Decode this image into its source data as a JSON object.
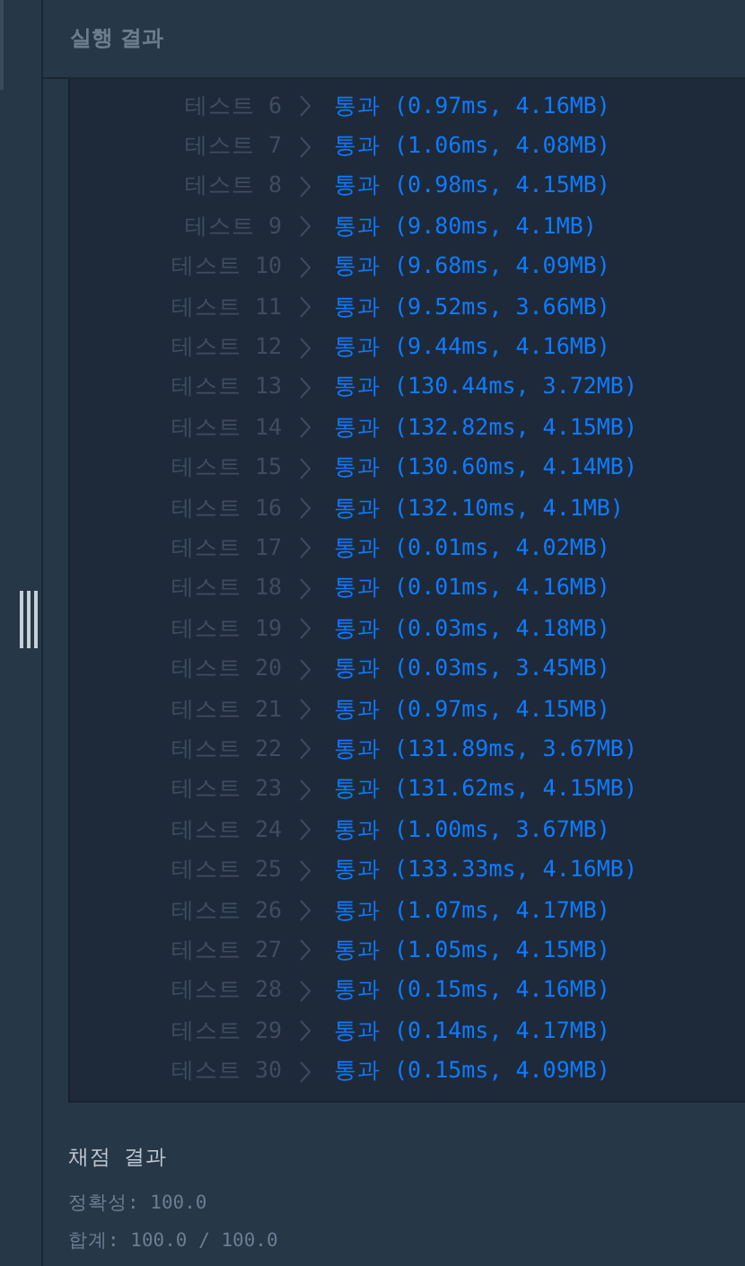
{
  "panel": {
    "title": "실행 결과"
  },
  "tests": [
    {
      "label": "테스트 6",
      "result": "통과 (0.97ms, 4.16MB)",
      "passed": true
    },
    {
      "label": "테스트 7",
      "result": "통과 (1.06ms, 4.08MB)",
      "passed": true
    },
    {
      "label": "테스트 8",
      "result": "통과 (0.98ms, 4.15MB)",
      "passed": true
    },
    {
      "label": "테스트 9",
      "result": "통과 (9.80ms, 4.1MB)",
      "passed": true
    },
    {
      "label": "테스트 10",
      "result": "통과 (9.68ms, 4.09MB)",
      "passed": true
    },
    {
      "label": "테스트 11",
      "result": "통과 (9.52ms, 3.66MB)",
      "passed": true
    },
    {
      "label": "테스트 12",
      "result": "통과 (9.44ms, 4.16MB)",
      "passed": true
    },
    {
      "label": "테스트 13",
      "result": "통과 (130.44ms, 3.72MB)",
      "passed": true
    },
    {
      "label": "테스트 14",
      "result": "통과 (132.82ms, 4.15MB)",
      "passed": true
    },
    {
      "label": "테스트 15",
      "result": "통과 (130.60ms, 4.14MB)",
      "passed": true
    },
    {
      "label": "테스트 16",
      "result": "통과 (132.10ms, 4.1MB)",
      "passed": true
    },
    {
      "label": "테스트 17",
      "result": "통과 (0.01ms, 4.02MB)",
      "passed": true
    },
    {
      "label": "테스트 18",
      "result": "통과 (0.01ms, 4.16MB)",
      "passed": true
    },
    {
      "label": "테스트 19",
      "result": "통과 (0.03ms, 4.18MB)",
      "passed": true
    },
    {
      "label": "테스트 20",
      "result": "통과 (0.03ms, 3.45MB)",
      "passed": true
    },
    {
      "label": "테스트 21",
      "result": "통과 (0.97ms, 4.15MB)",
      "passed": true
    },
    {
      "label": "테스트 22",
      "result": "통과 (131.89ms, 3.67MB)",
      "passed": true
    },
    {
      "label": "테스트 23",
      "result": "통과 (131.62ms, 4.15MB)",
      "passed": true
    },
    {
      "label": "테스트 24",
      "result": "통과 (1.00ms, 3.67MB)",
      "passed": true
    },
    {
      "label": "테스트 25",
      "result": "통과 (133.33ms, 4.16MB)",
      "passed": true
    },
    {
      "label": "테스트 26",
      "result": "통과 (1.07ms, 4.17MB)",
      "passed": true
    },
    {
      "label": "테스트 27",
      "result": "통과 (1.05ms, 4.15MB)",
      "passed": true
    },
    {
      "label": "테스트 28",
      "result": "통과 (0.15ms, 4.16MB)",
      "passed": true
    },
    {
      "label": "테스트 29",
      "result": "통과 (0.14ms, 4.17MB)",
      "passed": true
    },
    {
      "label": "테스트 30",
      "result": "통과 (0.15ms, 4.09MB)",
      "passed": true
    }
  ],
  "grading": {
    "title": "채점 결과",
    "lines": [
      "정확성: 100.0",
      "합계: 100.0 / 100.0"
    ]
  }
}
